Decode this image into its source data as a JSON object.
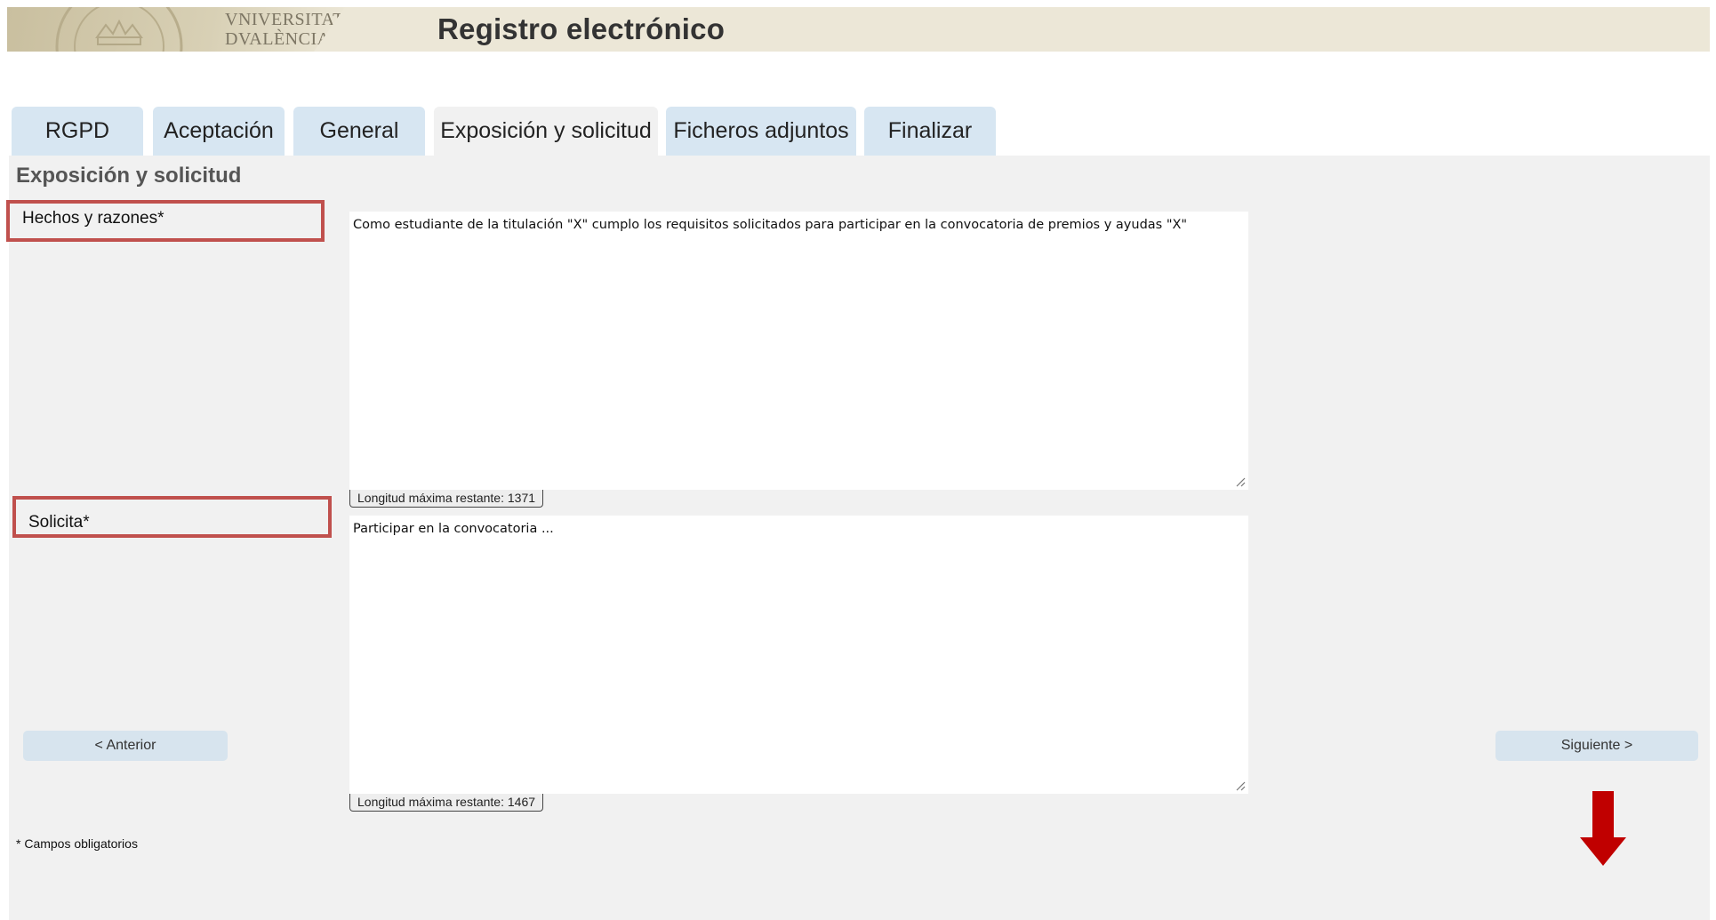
{
  "header": {
    "logo_line1": "VNIVERSITAT",
    "logo_line2": "DVALÈNCIA",
    "title": "Registro electrónico"
  },
  "tabs": [
    {
      "label": "RGPD",
      "active": false
    },
    {
      "label": "Aceptación",
      "active": false
    },
    {
      "label": "General",
      "active": false
    },
    {
      "label": "Exposición y solicitud",
      "active": true
    },
    {
      "label": "Ficheros adjuntos",
      "active": false
    },
    {
      "label": "Finalizar",
      "active": false
    }
  ],
  "form": {
    "section_title": "Exposición y solicitud",
    "hechos": {
      "label": "Hechos y razones*",
      "value": "Como estudiante de la titulación \"X\" cumplo los requisitos solicitados para participar en la convocatoria de premios y ayudas \"X\"",
      "counter": "Longitud máxima restante: 1371"
    },
    "solicita": {
      "label": "Solicita*",
      "value": "Participar en la convocatoria ...",
      "counter": "Longitud máxima restante: 1467"
    },
    "required_note": "* Campos obligatorios"
  },
  "nav": {
    "previous": "< Anterior",
    "next": "Siguiente >"
  },
  "colors": {
    "tab_bg": "#d7e6f2",
    "panel_bg": "#f1f1f1",
    "highlight_border": "#c0504d",
    "arrow": "#c00000"
  }
}
